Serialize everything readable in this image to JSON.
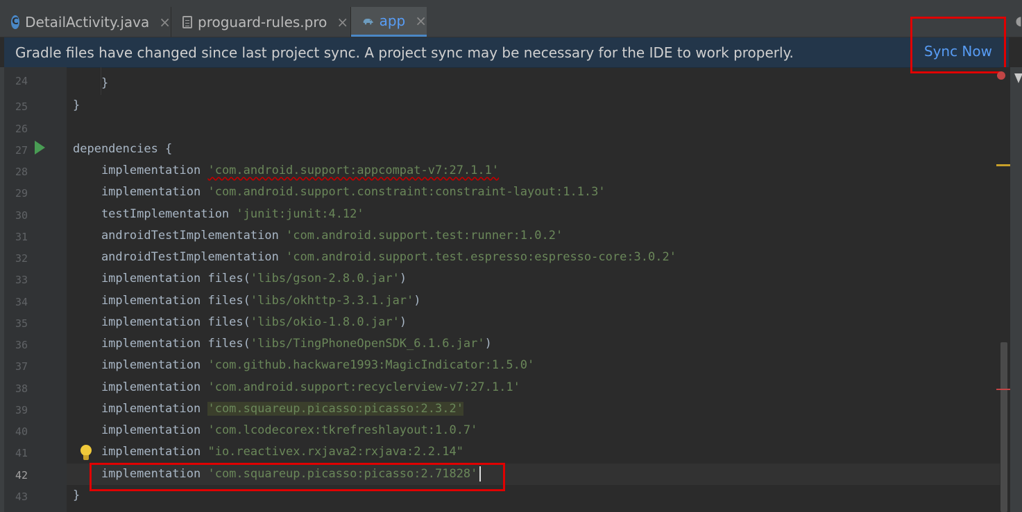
{
  "tabs": [
    {
      "label": "DetailActivity.java",
      "icon": "java-class-icon",
      "icon_glyph": "C",
      "active": false
    },
    {
      "label": "proguard-rules.pro",
      "icon": "file-icon",
      "active": false
    },
    {
      "label": "app",
      "icon": "gradle-elephant-icon",
      "active": true
    }
  ],
  "tab_close_glyph": "×",
  "banner": {
    "message": "Gradle files have changed since last project sync. A project sync may be necessary for the IDE to work properly.",
    "action": "Sync Now"
  },
  "editor": {
    "current_line": "42",
    "lines": [
      {
        "no": "24",
        "code": "    }"
      },
      {
        "no": "25",
        "code": "}"
      },
      {
        "no": "26",
        "code": ""
      },
      {
        "no": "27",
        "code": "dependencies {"
      },
      {
        "no": "28",
        "code": "    implementation ",
        "str": "'com.android.support:appcompat-v7:27.1.1'"
      },
      {
        "no": "29",
        "code": "    implementation ",
        "str": "'com.android.support.constraint:constraint-layout:1.1.3'"
      },
      {
        "no": "30",
        "code": "    testImplementation ",
        "str": "'junit:junit:4.12'"
      },
      {
        "no": "31",
        "code": "    androidTestImplementation ",
        "str": "'com.android.support.test:runner:1.0.2'"
      },
      {
        "no": "32",
        "code": "    androidTestImplementation ",
        "str": "'com.android.support.test.espresso:espresso-core:3.0.2'"
      },
      {
        "no": "33",
        "code": "    implementation files(",
        "str": "'libs/gson-2.8.0.jar'",
        "tail": ")"
      },
      {
        "no": "34",
        "code": "    implementation files(",
        "str": "'libs/okhttp-3.3.1.jar'",
        "tail": ")"
      },
      {
        "no": "35",
        "code": "    implementation files(",
        "str": "'libs/okio-1.8.0.jar'",
        "tail": ")"
      },
      {
        "no": "36",
        "code": "    implementation files(",
        "str": "'libs/TingPhoneOpenSDK_6.1.6.jar'",
        "tail": ")"
      },
      {
        "no": "37",
        "code": "    implementation ",
        "str": "'com.github.hackware1993:MagicIndicator:1.5.0'"
      },
      {
        "no": "38",
        "code": "    implementation ",
        "str": "'com.android.support:recyclerview-v7:27.1.1'"
      },
      {
        "no": "39",
        "code": "    implementation ",
        "str": "'com.squareup.picasso:picasso:2.3.2'"
      },
      {
        "no": "40",
        "code": "    implementation ",
        "str": "'com.lcodecorex:tkrefreshlayout:1.0.7'"
      },
      {
        "no": "41",
        "code": "    implementation ",
        "str": "\"io.reactivex.rxjava2:rxjava:2.2.14\""
      },
      {
        "no": "42",
        "code": "    implementation ",
        "str": "'com.squareup.picasso:picasso:2.71828'"
      },
      {
        "no": "43",
        "code": "}"
      }
    ]
  },
  "colors": {
    "background": "#2b2b2b",
    "string": "#6a8759",
    "keyword_text": "#a9b7c6",
    "link": "#589df6",
    "highlight_box": "#e00000"
  }
}
